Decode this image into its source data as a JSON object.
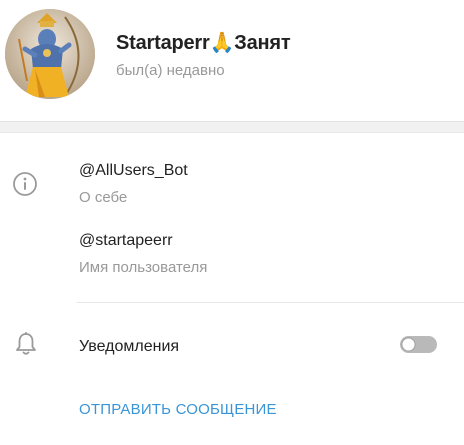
{
  "profile": {
    "display_name": "Startaperr🙏Занят",
    "status": "был(а) недавно",
    "avatar_icon": "avatar-image"
  },
  "info": {
    "bio_value": "@AllUsers_Bot",
    "bio_label": "О себе",
    "username_value": "@startapeerr",
    "username_label": "Имя пользователя",
    "info_icon": "info-circle-icon"
  },
  "notifications": {
    "label": "Уведомления",
    "enabled": false,
    "icon": "bell-icon"
  },
  "actions": {
    "send_message_label": "ОТПРАВИТЬ СООБЩЕНИЕ"
  },
  "colors": {
    "accent": "#3a95d6",
    "secondary_text": "#999999",
    "primary_text": "#222222",
    "divider": "#f1f1f1"
  }
}
